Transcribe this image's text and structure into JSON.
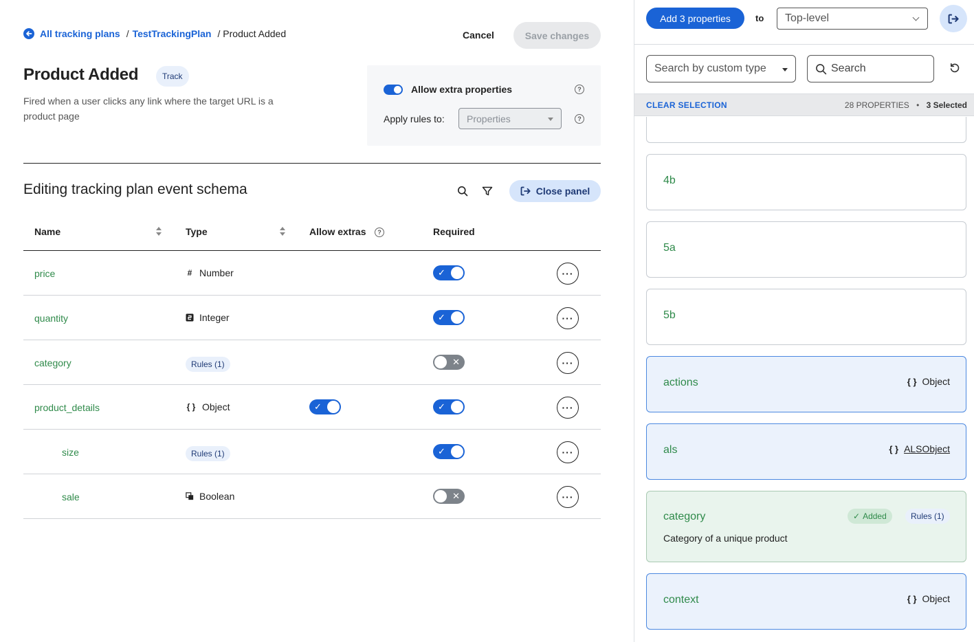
{
  "breadcrumb": {
    "items": [
      "All tracking plans",
      "TestTrackingPlan"
    ],
    "separator": "/",
    "current": "/ Product Added"
  },
  "header": {
    "cancel_label": "Cancel",
    "save_label": "Save changes",
    "title": "Product Added",
    "badge": "Track",
    "description": "Fired when a user clicks any link where the target URL is a product page"
  },
  "settings": {
    "allow_extra_label": "Allow extra properties",
    "allow_extra_on": true,
    "apply_rules_label": "Apply rules to:",
    "apply_rules_value": "Properties",
    "help_glyph": "?"
  },
  "schema": {
    "title": "Editing tracking plan event schema",
    "close_panel_label": "Close panel",
    "columns": {
      "name": "Name",
      "type": "Type",
      "allow_extras": "Allow extras",
      "required": "Required"
    },
    "rows": [
      {
        "name": "price",
        "type": "Number",
        "type_icon": "#",
        "rules": "",
        "allow_extras": null,
        "required": true,
        "indent": 0
      },
      {
        "name": "quantity",
        "type": "Integer",
        "type_icon": "integer-icon",
        "rules": "",
        "allow_extras": null,
        "required": true,
        "indent": 0
      },
      {
        "name": "category",
        "type": "",
        "type_icon": "",
        "rules": "Rules (1)",
        "allow_extras": null,
        "required": false,
        "indent": 0
      },
      {
        "name": "product_details",
        "type": "Object",
        "type_icon": "{ }",
        "rules": "",
        "allow_extras": true,
        "required": true,
        "indent": 0
      },
      {
        "name": "size",
        "type": "",
        "type_icon": "",
        "rules": "Rules (1)",
        "allow_extras": null,
        "required": true,
        "indent": 1
      },
      {
        "name": "sale",
        "type": "Boolean",
        "type_icon": "boolean-icon",
        "rules": "",
        "allow_extras": null,
        "required": false,
        "indent": 1
      }
    ],
    "more_glyph": "···",
    "check_glyph": "✓",
    "x_glyph": "✕"
  },
  "panel": {
    "add_label": "Add 3 properties",
    "to_label": "to",
    "target_value": "Top-level",
    "custom_type_placeholder": "Search by custom type",
    "search_placeholder": "Search",
    "clear_selection": "CLEAR SELECTION",
    "properties_count": "28 PROPERTIES",
    "bullet": "•",
    "selected_count": "3 Selected",
    "cards": [
      {
        "name": "",
        "type": "",
        "state": "plain"
      },
      {
        "name": "4b",
        "type": "",
        "state": "plain"
      },
      {
        "name": "5a",
        "type": "",
        "state": "plain"
      },
      {
        "name": "5b",
        "type": "",
        "state": "plain"
      },
      {
        "name": "actions",
        "type": "Object",
        "state": "selected"
      },
      {
        "name": "als",
        "type": "ALSObject",
        "state": "selected",
        "type_link": true
      },
      {
        "name": "category",
        "type": "",
        "state": "added",
        "added_label": "Added",
        "rules": "Rules (1)",
        "description": "Category of a unique product"
      },
      {
        "name": "context",
        "type": "Object",
        "state": "selected"
      }
    ]
  },
  "colors": {
    "accent": "#1a63d6",
    "property_name": "#2f8a4a",
    "selected_bg": "#ebf2fc",
    "added_bg": "#e9f4ed"
  }
}
